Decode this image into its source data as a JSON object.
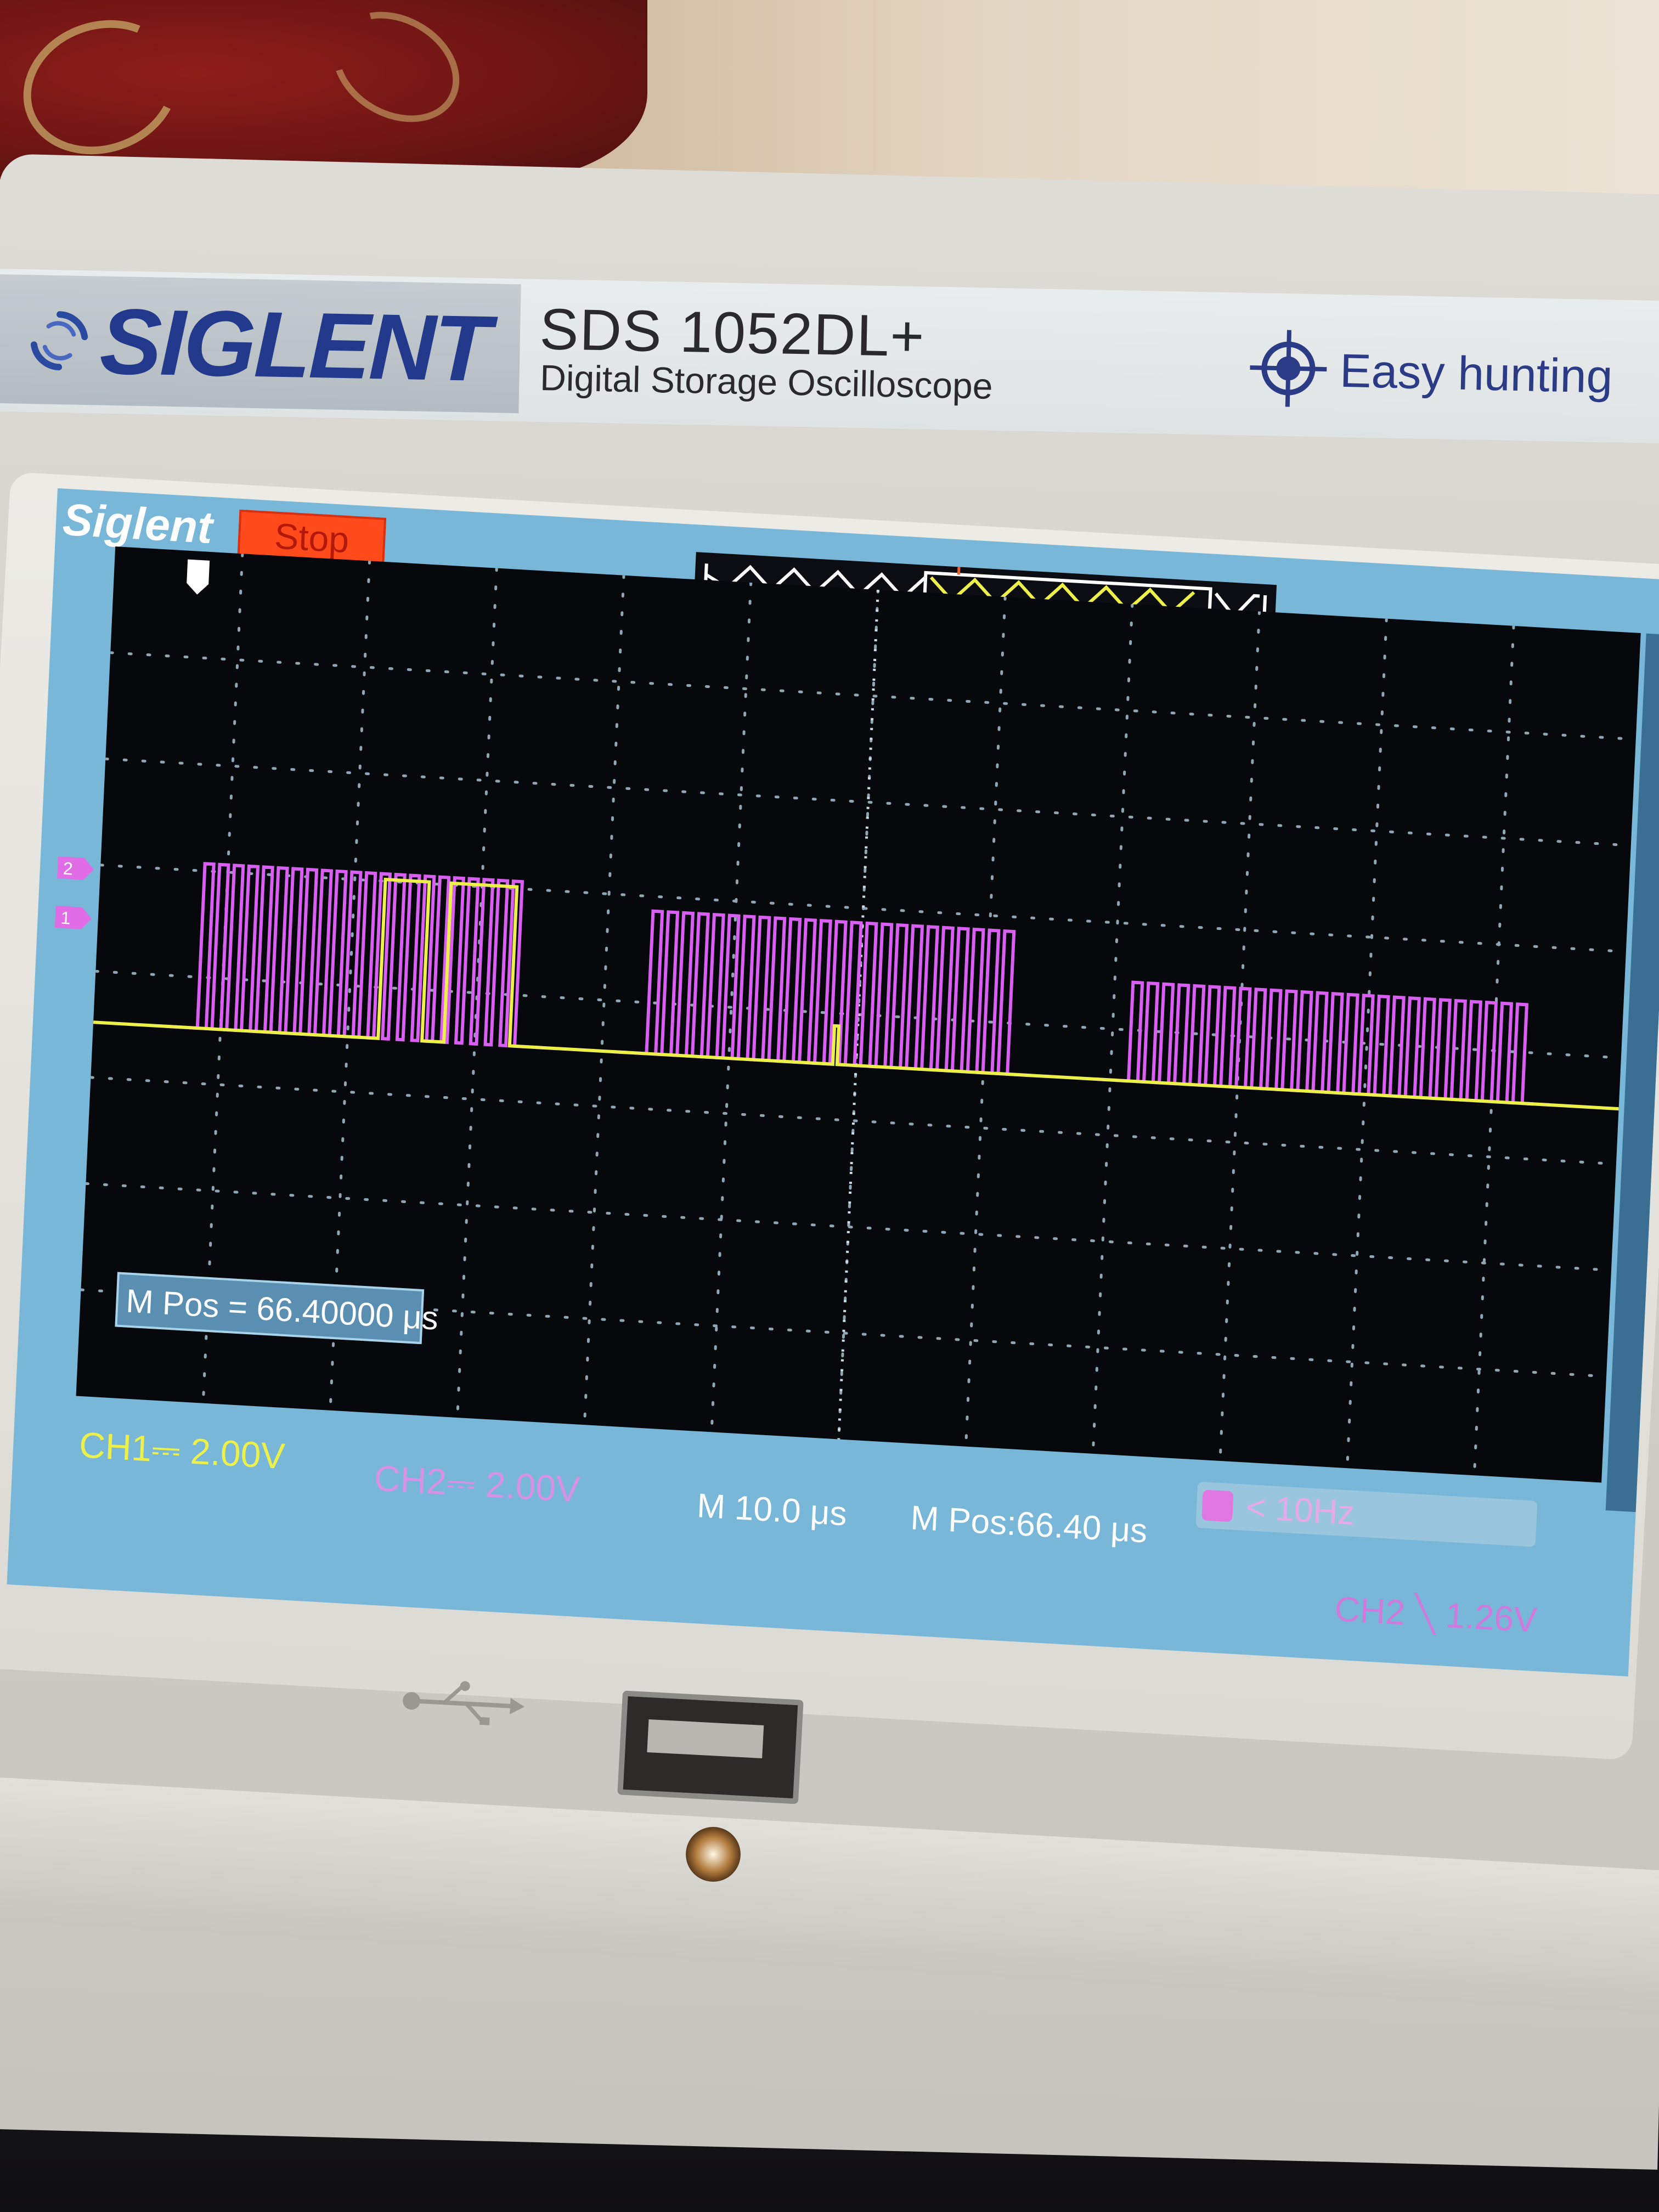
{
  "brand": {
    "logo_text": "SIGLENT",
    "model": "SDS 1052DL+",
    "subtitle": "Digital Storage Oscilloscope",
    "feature": "Easy hunting"
  },
  "screen": {
    "brand": "Siglent",
    "run_state": "Stop",
    "memory_position_box": "M Pos = 66.40000 μs",
    "ch1_scale": "CH1⎓ 2.00V",
    "ch2_scale": "CH2⎓ 2.00V",
    "timebase": "M 10.0 μs",
    "memory_position": "M Pos:66.40 μs",
    "trigger_frequency": "< 10Hz",
    "trigger_level": "CH2 ╲ 1.26V"
  },
  "colors": {
    "ch1": "#eef04a",
    "ch2": "#d95ff2",
    "screen_frame": "#78b7d8",
    "stop": "#ff4a1c",
    "brand_blue": "#233a8c"
  },
  "icons": [
    "trigger-position-marker-icon",
    "ch2-marker-icon",
    "ch1-marker-icon",
    "usb-icon",
    "crosshair-icon",
    "sync-icon"
  ]
}
